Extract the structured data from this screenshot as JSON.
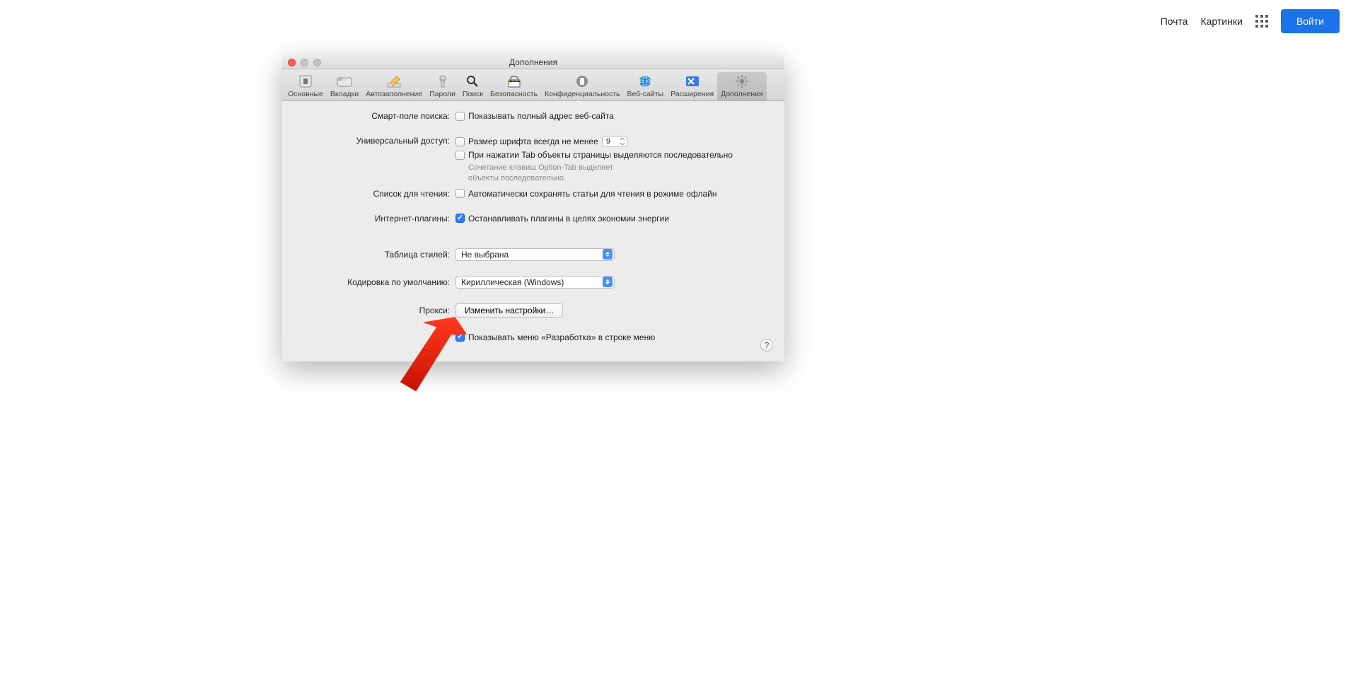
{
  "topbar": {
    "mail": "Почта",
    "images": "Картинки",
    "login": "Войти"
  },
  "window": {
    "title": "Дополнения",
    "tabs": [
      "Основные",
      "Вкладки",
      "Автозаполнение",
      "Пароли",
      "Поиск",
      "Безопасность",
      "Конфиденциальность",
      "Веб-сайты",
      "Расширения",
      "Дополнения"
    ],
    "activeTab": 9
  },
  "labels": {
    "smart": "Смарт-поле поиска:",
    "universal": "Универсальный доступ:",
    "reading": "Список для чтения:",
    "plugins": "Интернет-плагины:",
    "stylesheet": "Таблица стилей:",
    "encoding": "Кодировка по умолчанию:",
    "proxy": "Прокси:"
  },
  "checks": {
    "fullurl": "Показывать полный адрес веб-сайта",
    "fontsize": "Размер шрифта всегда не менее",
    "tab": "При нажатии Tab объекты страницы выделяются последовательно",
    "tabHint": "Сочетание клавиш Option-Tab выделяет объекты последовательно.",
    "reading": "Автоматически сохранять статьи для чтения в режиме офлайн",
    "plugins": "Останавливать плагины в целях экономии энергии",
    "develop": "Показывать меню «Разработка» в строке меню"
  },
  "values": {
    "fontsize": "9",
    "stylesheet": "Не выбрана",
    "encoding": "Кириллическая (Windows)",
    "proxyBtn": "Изменить настройки…"
  }
}
